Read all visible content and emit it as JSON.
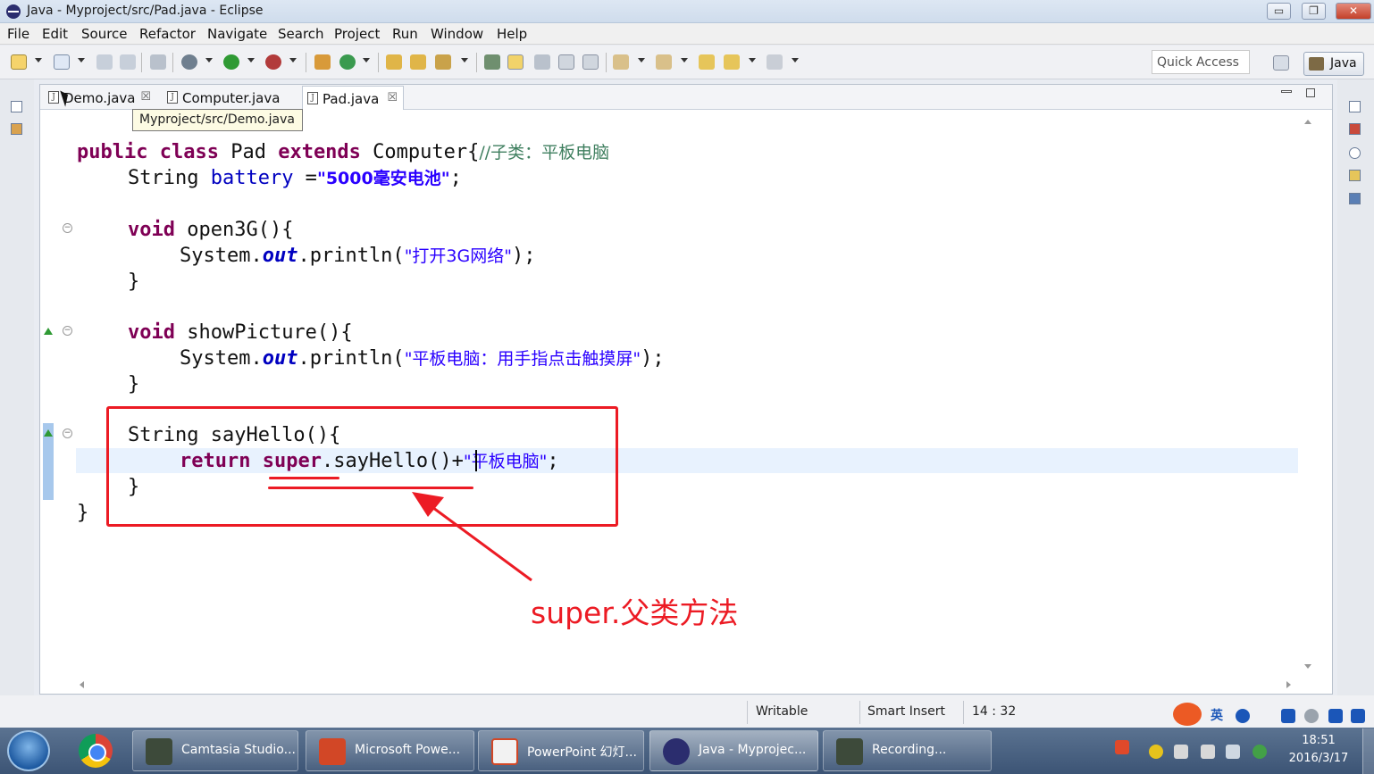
{
  "window": {
    "title": "Java - Myproject/src/Pad.java - Eclipse",
    "minimize": "▭",
    "restore": "❐",
    "close": "✕"
  },
  "menu": [
    "File",
    "Edit",
    "Source",
    "Refactor",
    "Navigate",
    "Search",
    "Project",
    "Run",
    "Window",
    "Help"
  ],
  "toolbar": {
    "quick_access": "Quick Access",
    "perspective": "Java"
  },
  "tabs": [
    {
      "label": "Demo.java",
      "close": "☒"
    },
    {
      "label": "Computer.java"
    },
    {
      "label": "Pad.java",
      "close": "☒"
    }
  ],
  "tooltip": "Myproject/src/Demo.java",
  "code": {
    "l1_kw1": "public",
    "l1_kw2": "class",
    "l1_name": " Pad ",
    "l1_kw3": "extends",
    "l1_super": " Computer{",
    "l1_comment": "//子类：平板电脑",
    "l2_type": "String ",
    "l2_field": "battery",
    "l2_eq": " =",
    "l2_str": "\"5000毫安电池\"",
    "l2_end": ";",
    "l3_kw": "void",
    "l3_rest": " open3G(){",
    "l4_a": "System.",
    "l4_out": "out",
    "l4_b": ".println(",
    "l4_str": "\"打开3G网络\"",
    "l4_end": ");",
    "brace": "}",
    "l6_kw": "void",
    "l6_rest": " showPicture(){",
    "l7_a": "System.",
    "l7_out": "out",
    "l7_b": ".println(",
    "l7_str": "\"平板电脑：用手指点击触摸屏\"",
    "l7_end": ");",
    "l9_rest": "String sayHello(){",
    "l10_kw": "return",
    "l10_kw2": "super",
    "l10_rest": ".sayHello()",
    "l10_plus": "+",
    "l10_str": "\"平板电脑\"",
    "l10_end": ";"
  },
  "annotation": "super.父类方法",
  "status": {
    "writable": "Writable",
    "insert_mode": "Smart Insert",
    "position": "14 : 32"
  },
  "taskbar": {
    "tasks": [
      "Camtasia Studio...",
      "Microsoft Powe...",
      "PowerPoint 幻灯...",
      "Java - Myprojec...",
      "Recording..."
    ],
    "ime": "英",
    "time": "18:51",
    "date": "2016/3/17"
  },
  "colors": {
    "keyword": "#7f0055",
    "field": "#0000c0",
    "string": "#2a00ff",
    "comment": "#3f7f5f",
    "annotation": "#ec1b24"
  },
  "icons": [
    "eclipse-icon",
    "new-icon",
    "save-icon",
    "debug-icon",
    "run-icon",
    "search-icon",
    "java-perspective-icon",
    "chrome-icon",
    "windows-start-icon"
  ]
}
